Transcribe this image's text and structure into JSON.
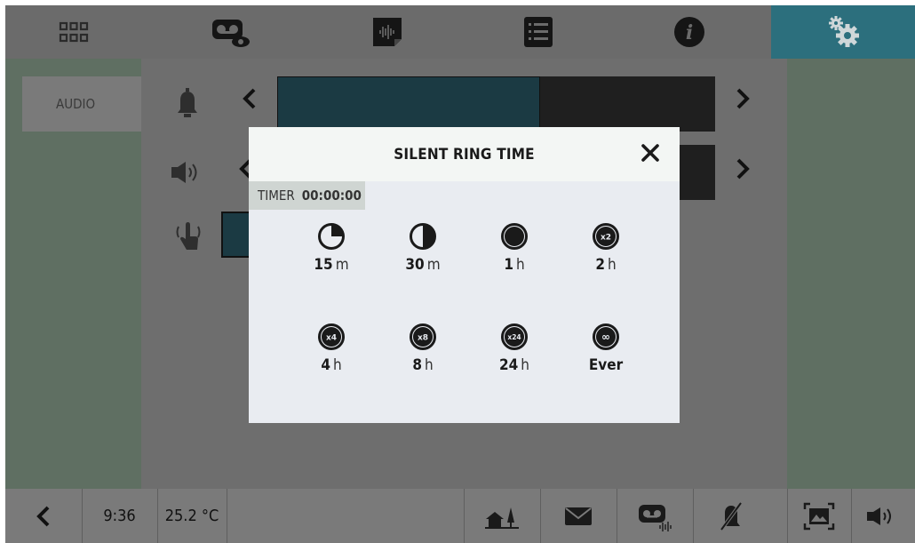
{
  "top_nav": {
    "items": [
      {
        "name": "apps",
        "icon": "grid-icon"
      },
      {
        "name": "video-messages",
        "icon": "voicemail-eye-icon"
      },
      {
        "name": "audio-messages",
        "icon": "audio-note-icon"
      },
      {
        "name": "list",
        "icon": "list-icon"
      },
      {
        "name": "info",
        "icon": "info-icon"
      },
      {
        "name": "settings",
        "icon": "settings-gears-icon",
        "active": true
      }
    ]
  },
  "sidebar": {
    "tab_label": "AUDIO"
  },
  "settings_rows": {
    "ringtone_volume_fraction": 0.6,
    "icons": [
      "bell-icon",
      "speaker-icon",
      "touch-icon"
    ]
  },
  "modal": {
    "title": "SILENT RING TIME",
    "timer_label": "TIMER",
    "timer_value": "00:00:00",
    "options": [
      {
        "icon": "quarter-clock-icon",
        "value": "15",
        "unit": "m"
      },
      {
        "icon": "half-clock-icon",
        "value": "30",
        "unit": "m"
      },
      {
        "icon": "full-clock-icon",
        "value": "1",
        "unit": "h"
      },
      {
        "icon": "x2-icon",
        "badge": "x2",
        "value": "2",
        "unit": "h"
      },
      {
        "icon": "x4-icon",
        "badge": "x4",
        "value": "4",
        "unit": "h"
      },
      {
        "icon": "x8-icon",
        "badge": "x8",
        "value": "8",
        "unit": "h"
      },
      {
        "icon": "x24-icon",
        "badge": "x24",
        "value": "24",
        "unit": "h"
      },
      {
        "icon": "infinity-icon",
        "badge": "∞",
        "value": "Ever",
        "unit": ""
      }
    ]
  },
  "bottom_bar": {
    "time": "9:36",
    "temperature": "25.2 °C",
    "icons": [
      "back-icon",
      "home-icon",
      "mail-icon",
      "voicemail-audio-icon",
      "bell-muted-icon",
      "image-icon",
      "volume-icon"
    ]
  },
  "colors": {
    "accent": "#2c6f7d",
    "modal_bg": "#e9ecf1",
    "overlay_dark": "#6e6e6e"
  }
}
